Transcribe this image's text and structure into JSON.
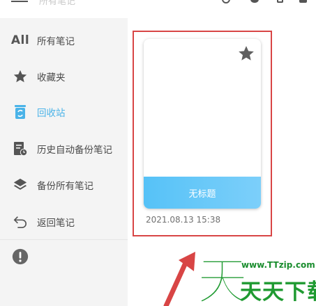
{
  "header": {
    "title": "所有笔记",
    "icons": [
      "menu-icon",
      "search-icon",
      "bell-icon",
      "phone-icon",
      "trash-icon"
    ]
  },
  "sidebar": {
    "items": [
      {
        "icon": "all-text-icon",
        "icon_text": "All",
        "label": "所有笔记"
      },
      {
        "icon": "star-icon",
        "label": "收藏夹"
      },
      {
        "icon": "recycle-bin-icon",
        "label": "回收站",
        "active": true
      },
      {
        "icon": "history-backup-icon",
        "label": "历史自动备份笔记"
      },
      {
        "icon": "layers-icon",
        "label": "备份所有笔记"
      },
      {
        "icon": "return-icon",
        "label": "返回笔记"
      },
      {
        "icon": "exclamation-icon",
        "label": ""
      }
    ]
  },
  "note": {
    "title": "无标题",
    "date": "2021.08.13 15:38"
  },
  "watermark": {
    "big_char": "天",
    "url": "www.TTzip.com",
    "name": "天天下载"
  },
  "colors": {
    "accent": "#4ab3e8",
    "card_footer": "#56c2f7",
    "highlight": "#d84545",
    "watermark_green": "#1f9a31"
  }
}
